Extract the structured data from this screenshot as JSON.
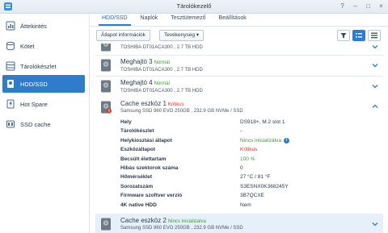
{
  "window": {
    "title": "Tárolókezelő"
  },
  "sidebar": {
    "items": [
      {
        "label": "Áttekintés",
        "icon": "overview-icon"
      },
      {
        "label": "Kötet",
        "icon": "volume-icon"
      },
      {
        "label": "Tárolókészlet",
        "icon": "storage-pool-icon"
      },
      {
        "label": "HDD/SSD",
        "icon": "hdd-icon",
        "active": true
      },
      {
        "label": "Hot Spare",
        "icon": "hot-spare-icon"
      },
      {
        "label": "SSD cache",
        "icon": "ssd-cache-icon"
      }
    ]
  },
  "tabs": [
    "HDD/SSD",
    "Naplók",
    "Tesztütemező",
    "Beállítások"
  ],
  "toolbar": {
    "info_button": "Állapot információk",
    "action_button": "Tevékenység",
    "action_arrow": "▾"
  },
  "disks": {
    "top_sub": "TOSHIBA DT01ACA300 , 2.7 TB HDD",
    "d3": {
      "name": "Meghajtó 3",
      "status": "Normál",
      "sub": "TOSHIBA DT01ACA300 , 2.7 TB HDD"
    },
    "d4": {
      "name": "Meghajtó 4",
      "status": "Normál",
      "sub": "TOSHIBA DT01ACA300 , 2.7 TB HDD"
    },
    "c1": {
      "name": "Cache eszköz 1",
      "status": "Kritikus",
      "sub": "Samsung SSD 960 EVO 250GB , 232.9 GB NVMe / SSD"
    },
    "c2": {
      "name": "Cache eszköz 2",
      "status": "Nincs inicializálva",
      "sub": "Samsung SSD 960 EVO 250GB , 232.9 GB NVMe / SSD"
    }
  },
  "details": {
    "location": {
      "label": "Hely",
      "value": "DS918+, M.2 slot 1"
    },
    "pool": {
      "label": "Tárolókészlet",
      "value": "-"
    },
    "alloc": {
      "label": "Helykiosztási állapot",
      "value": "Nincs inicializálva"
    },
    "health": {
      "label": "Eszközállapot",
      "value": "Kritikus"
    },
    "life": {
      "label": "Becsült élettartam",
      "value": "100 %"
    },
    "badsectors": {
      "label": "Hibás szektorok száma",
      "value": "0"
    },
    "temp": {
      "label": "Hőmérséklet",
      "value": "27 °C / 81 °F"
    },
    "serial": {
      "label": "Sorozatszám",
      "value": "S3ESNX0K368245Y"
    },
    "firmware": {
      "label": "Firmware szoftver verzió",
      "value": "3B7QCXE"
    },
    "native4k": {
      "label": "4K native HDD",
      "value": "Nem"
    }
  },
  "colors": {
    "accent": "#2f7ccc",
    "ok": "#3a9b3a",
    "critical": "#d9342b"
  }
}
